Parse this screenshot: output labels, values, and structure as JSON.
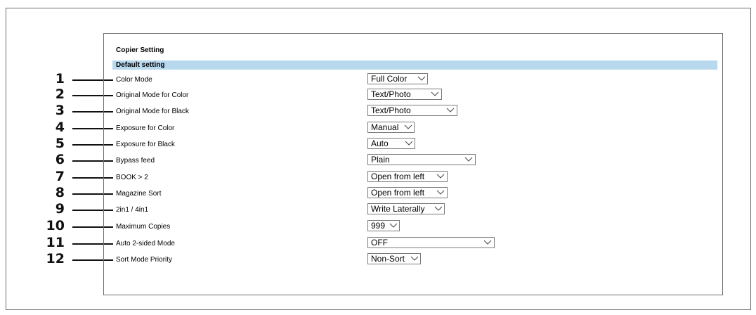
{
  "page": {
    "section_title": "Copier Setting",
    "section_header": "Default setting"
  },
  "rows": [
    {
      "num": "1",
      "label": "Color Mode",
      "value": "Full Color"
    },
    {
      "num": "2",
      "label": "Original Mode for Color",
      "value": "Text/Photo"
    },
    {
      "num": "3",
      "label": "Original Mode for Black",
      "value": "Text/Photo"
    },
    {
      "num": "4",
      "label": "Exposure for Color",
      "value": "Manual"
    },
    {
      "num": "5",
      "label": "Exposure for Black",
      "value": "Auto"
    },
    {
      "num": "6",
      "label": "Bypass feed",
      "value": "Plain"
    },
    {
      "num": "7",
      "label": "BOOK > 2",
      "value": "Open from left"
    },
    {
      "num": "8",
      "label": "Magazine Sort",
      "value": "Open from left"
    },
    {
      "num": "9",
      "label": "2in1 / 4in1",
      "value": "Write Laterally"
    },
    {
      "num": "10",
      "label": "Maximum Copies",
      "value": "999"
    },
    {
      "num": "11",
      "label": "Auto 2-sided Mode",
      "value": "OFF"
    },
    {
      "num": "12",
      "label": "Sort Mode Priority",
      "value": "Non-Sort"
    }
  ],
  "icons": {
    "dropdown": "chevron-down-icon"
  }
}
